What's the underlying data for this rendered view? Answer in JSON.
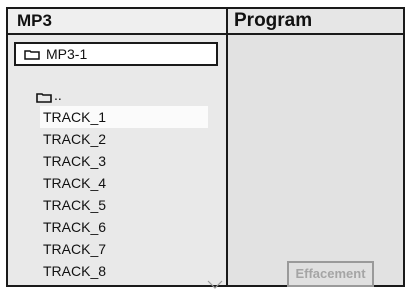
{
  "left_panel": {
    "title": "MP3",
    "current_folder": "MP3-1",
    "parent_dir": "..",
    "tracks": [
      "TRACK_1",
      "TRACK_2",
      "TRACK_3",
      "TRACK_4",
      "TRACK_5",
      "TRACK_6",
      "TRACK_7",
      "TRACK_8"
    ],
    "selected_track": "TRACK_1",
    "folder_icon": "folder-icon",
    "scroll_icon": "chevron-down-icon"
  },
  "right_panel": {
    "title": "Program",
    "clear_label": "Effacement"
  }
}
